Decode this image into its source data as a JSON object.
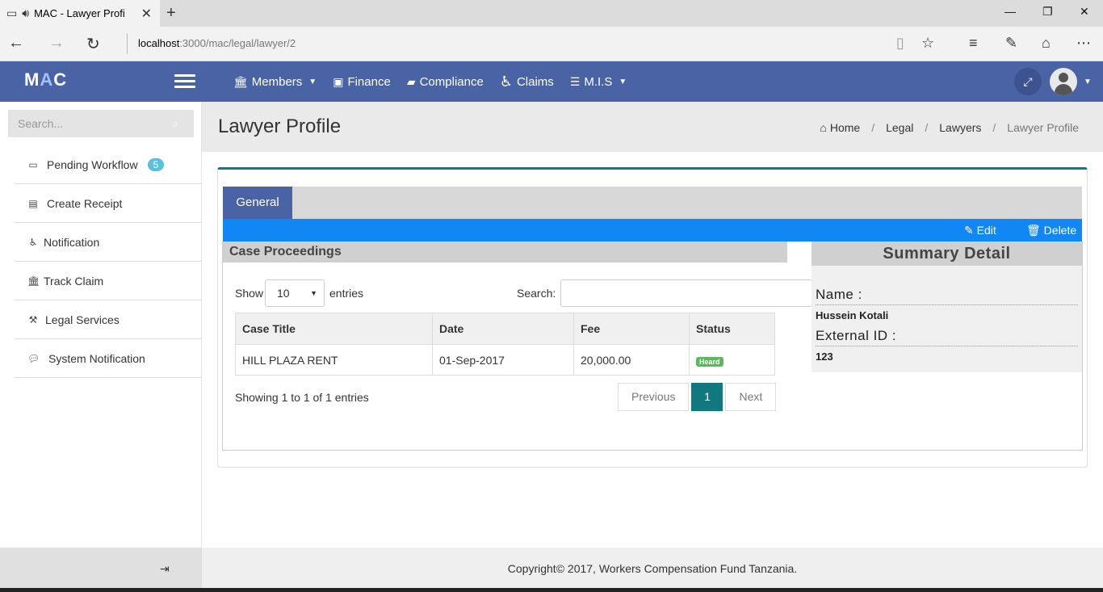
{
  "browser": {
    "tab_title": "MAC - Lawyer Profi",
    "url_host": "localhost",
    "url_rest": ":3000/mac/legal/lawyer/2"
  },
  "app": {
    "logo_m": "M",
    "logo_a": "A",
    "logo_c": "C",
    "nav": [
      {
        "label": "Members",
        "icon": "bank-icon"
      },
      {
        "label": "Finance",
        "icon": "money-icon"
      },
      {
        "label": "Compliance",
        "icon": "book-icon"
      },
      {
        "label": "Claims",
        "icon": "wheelchair-icon"
      },
      {
        "label": "M.I.S",
        "icon": "list-icon"
      }
    ]
  },
  "sidebar": {
    "search_placeholder": "Search...",
    "items": [
      {
        "label": "Pending Workflow",
        "badge": "5"
      },
      {
        "label": "Create Receipt"
      },
      {
        "label": "Notification"
      },
      {
        "label": "Track Claim"
      },
      {
        "label": "Legal Services"
      },
      {
        "label": "System Notification"
      }
    ]
  },
  "page": {
    "title": "Lawyer Profile",
    "breadcrumb": [
      "Home",
      "Legal",
      "Lawyers",
      "Lawyer Profile"
    ]
  },
  "tabs": {
    "general": "General"
  },
  "actions": {
    "edit": "Edit",
    "delete": "Delete"
  },
  "case_proceedings": {
    "heading": "Case Proceedings",
    "show_label": "Show",
    "length_value": "10",
    "entries_label": "entries",
    "search_label": "Search:",
    "columns": [
      "Case Title",
      "Date",
      "Fee",
      "Status"
    ],
    "rows": [
      {
        "case_title": "HILL PLAZA RENT",
        "date": "01-Sep-2017",
        "fee": "20,000.00",
        "status": "Heard"
      }
    ],
    "info": "Showing 1 to 1 of 1 entries",
    "pager": {
      "previous": "Previous",
      "current": "1",
      "next": "Next"
    }
  },
  "summary": {
    "heading": "Summary Detail",
    "name_label": "Name :",
    "name_value": "Hussein Kotali",
    "external_id_label": "External ID :",
    "external_id_value": "123"
  },
  "footer": {
    "copyright": "Copyright© 2017, Workers Compensation Fund Tanzania."
  },
  "colors": {
    "header": "#4a63a4",
    "action_bar": "#1187f5",
    "box_accent": "#0e7c86",
    "pager_active": "#117880",
    "badge": "#5bc0de",
    "status_heard": "#5cb85c"
  }
}
